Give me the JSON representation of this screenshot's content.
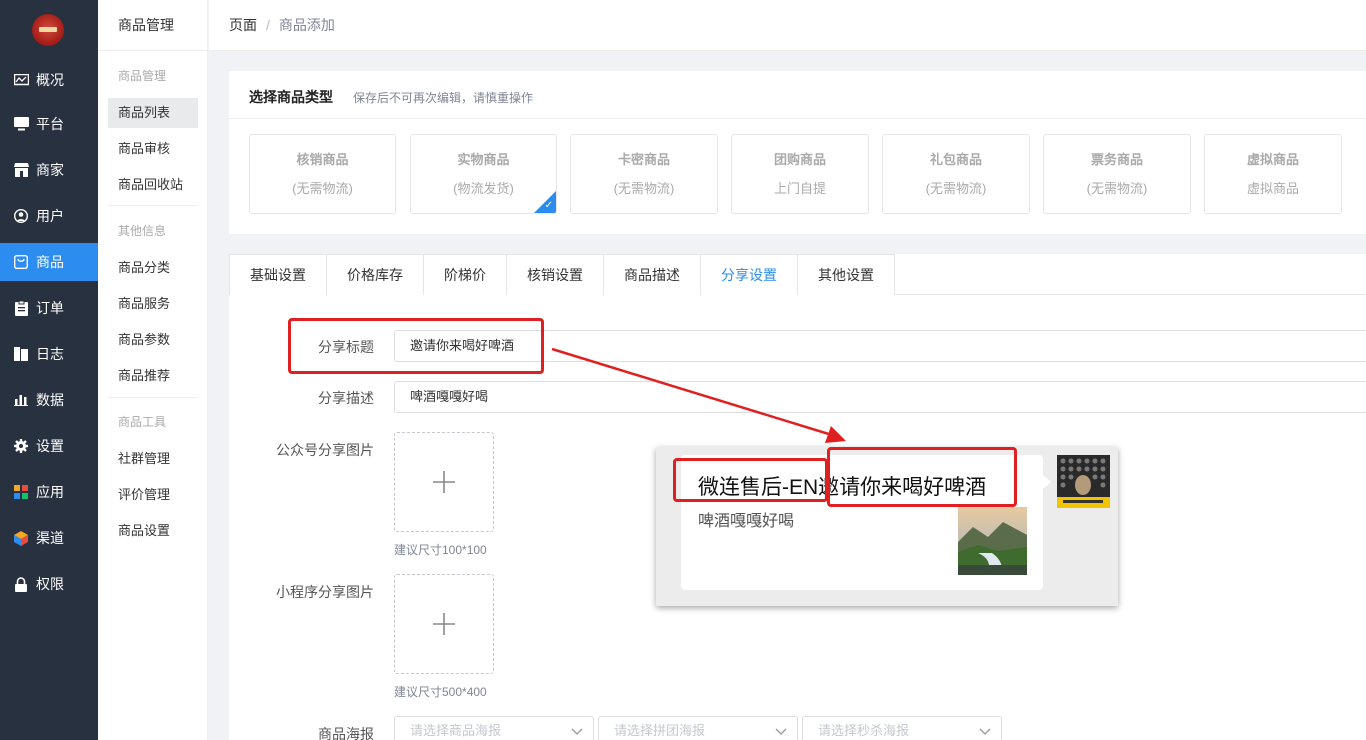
{
  "sidebar": {
    "items": [
      {
        "label": "概况",
        "icon": "dashboard-icon"
      },
      {
        "label": "平台",
        "icon": "monitor-icon"
      },
      {
        "label": "商家",
        "icon": "shop-icon"
      },
      {
        "label": "用户",
        "icon": "user-icon"
      },
      {
        "label": "商品",
        "icon": "goods-icon",
        "active": true
      },
      {
        "label": "订单",
        "icon": "order-icon"
      },
      {
        "label": "日志",
        "icon": "log-icon"
      },
      {
        "label": "数据",
        "icon": "chart-icon"
      },
      {
        "label": "设置",
        "icon": "gear-icon"
      },
      {
        "label": "应用",
        "icon": "apps-icon"
      },
      {
        "label": "渠道",
        "icon": "cube-icon"
      },
      {
        "label": "权限",
        "icon": "lock-icon"
      }
    ]
  },
  "submenu": {
    "title": "商品管理",
    "groups": [
      {
        "label": "商品管理",
        "items": [
          "商品列表",
          "商品审核",
          "商品回收站"
        ]
      },
      {
        "label": "其他信息",
        "items": [
          "商品分类",
          "商品服务",
          "商品参数",
          "商品推荐"
        ]
      },
      {
        "label": "商品工具",
        "items": [
          "社群管理",
          "评价管理",
          "商品设置"
        ]
      }
    ],
    "active": "商品列表"
  },
  "breadcrumb": {
    "root": "页面",
    "sep": "/",
    "current": "商品添加"
  },
  "type_section": {
    "title": "选择商品类型",
    "hint": "保存后不可再次编辑，请慎重操作",
    "types": [
      {
        "name": "核销商品",
        "sub": "(无需物流)"
      },
      {
        "name": "实物商品",
        "sub": "(物流发货)",
        "selected": true
      },
      {
        "name": "卡密商品",
        "sub": "(无需物流)"
      },
      {
        "name": "团购商品",
        "sub": "上门自提"
      },
      {
        "name": "礼包商品",
        "sub": "(无需物流)"
      },
      {
        "name": "票务商品",
        "sub": "(无需物流)"
      },
      {
        "name": "虚拟商品",
        "sub": "虚拟商品"
      }
    ]
  },
  "tabs": [
    "基础设置",
    "价格库存",
    "阶梯价",
    "核销设置",
    "商品描述",
    "分享设置",
    "其他设置"
  ],
  "active_tab": "分享设置",
  "form": {
    "share_title_label": "分享标题",
    "share_title_value": "邀请你来喝好啤酒",
    "share_desc_label": "分享描述",
    "share_desc_value": "啤酒嘎嘎好喝",
    "wx_image_label": "公众号分享图片",
    "wx_image_tip": "建议尺寸100*100",
    "mini_image_label": "小程序分享图片",
    "mini_image_tip": "建议尺寸500*400",
    "poster_label": "商品海报",
    "poster_selects": [
      "请选择商品海报",
      "请选择拼团海报",
      "请选择秒杀海报"
    ]
  },
  "preview": {
    "title_prefix": "微连售后-EN",
    "title_main": "邀请你来喝好啤酒",
    "desc": "啤酒嘎嘎好喝"
  },
  "colors": {
    "accent": "#2d8cf0",
    "sidebar_bg": "#28313f",
    "highlight": "#e02020"
  }
}
